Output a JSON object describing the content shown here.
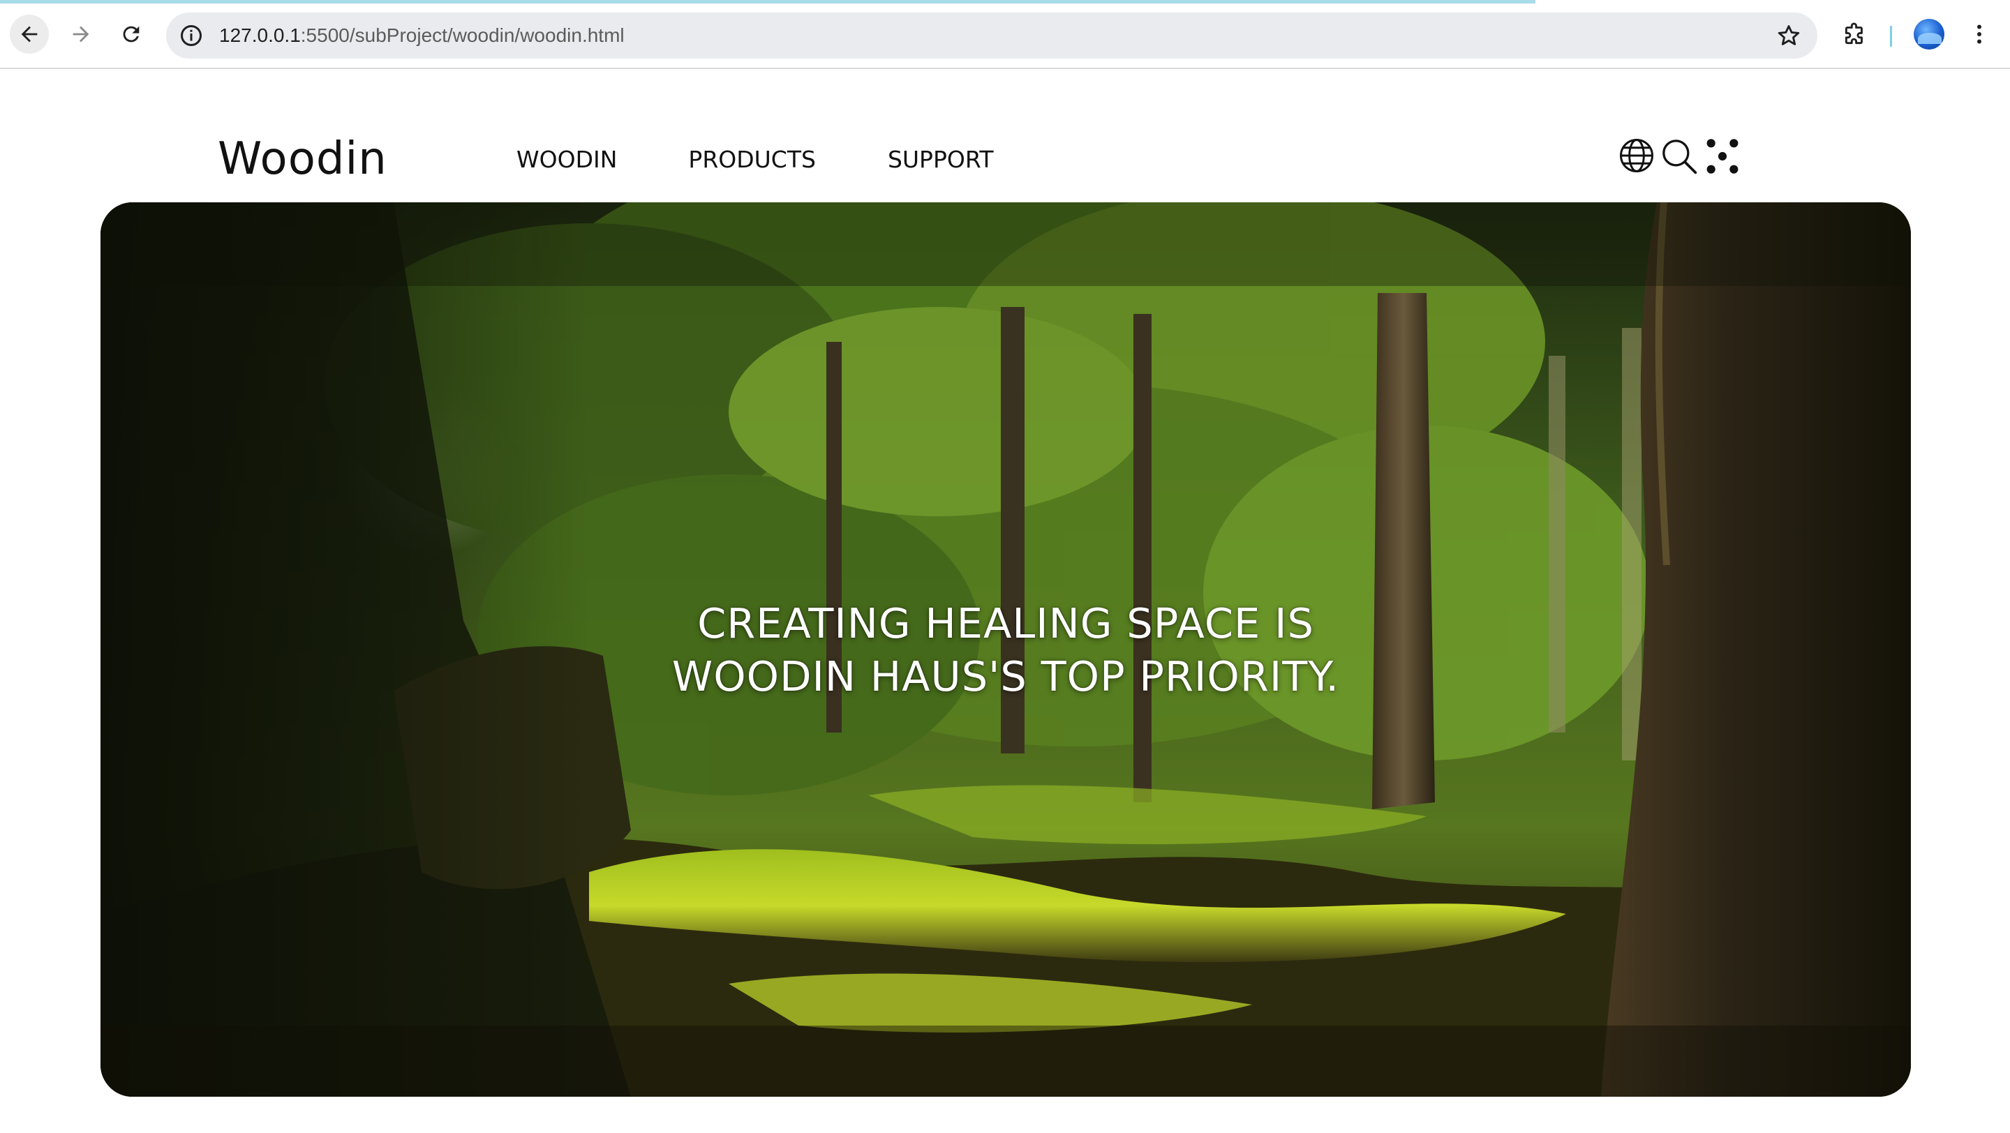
{
  "browser": {
    "url_host": "127.0.0.1",
    "url_path": ":5500/subProject/woodin/woodin.html",
    "icons": {
      "back": "arrow-left-icon",
      "forward": "arrow-right-icon",
      "reload": "reload-icon",
      "info": "info-icon",
      "bookmark": "star-icon",
      "extensions": "puzzle-icon",
      "profile": "avatar",
      "menu": "kebab-menu-icon"
    },
    "loading_bar_color": "#a8dce8"
  },
  "header": {
    "logo": "Woodin",
    "nav": {
      "woodin": "WOODIN",
      "products": "PRODUCTS",
      "support": "SUPPORT"
    },
    "icons": {
      "language": "globe-icon",
      "search": "search-icon",
      "menu": "dots-grid-icon"
    }
  },
  "hero": {
    "headline_line1": "CREATING HEALING SPACE IS",
    "headline_line2": "WOODIN HAUS'S TOP PRIORITY.",
    "image": "forest-scene"
  }
}
